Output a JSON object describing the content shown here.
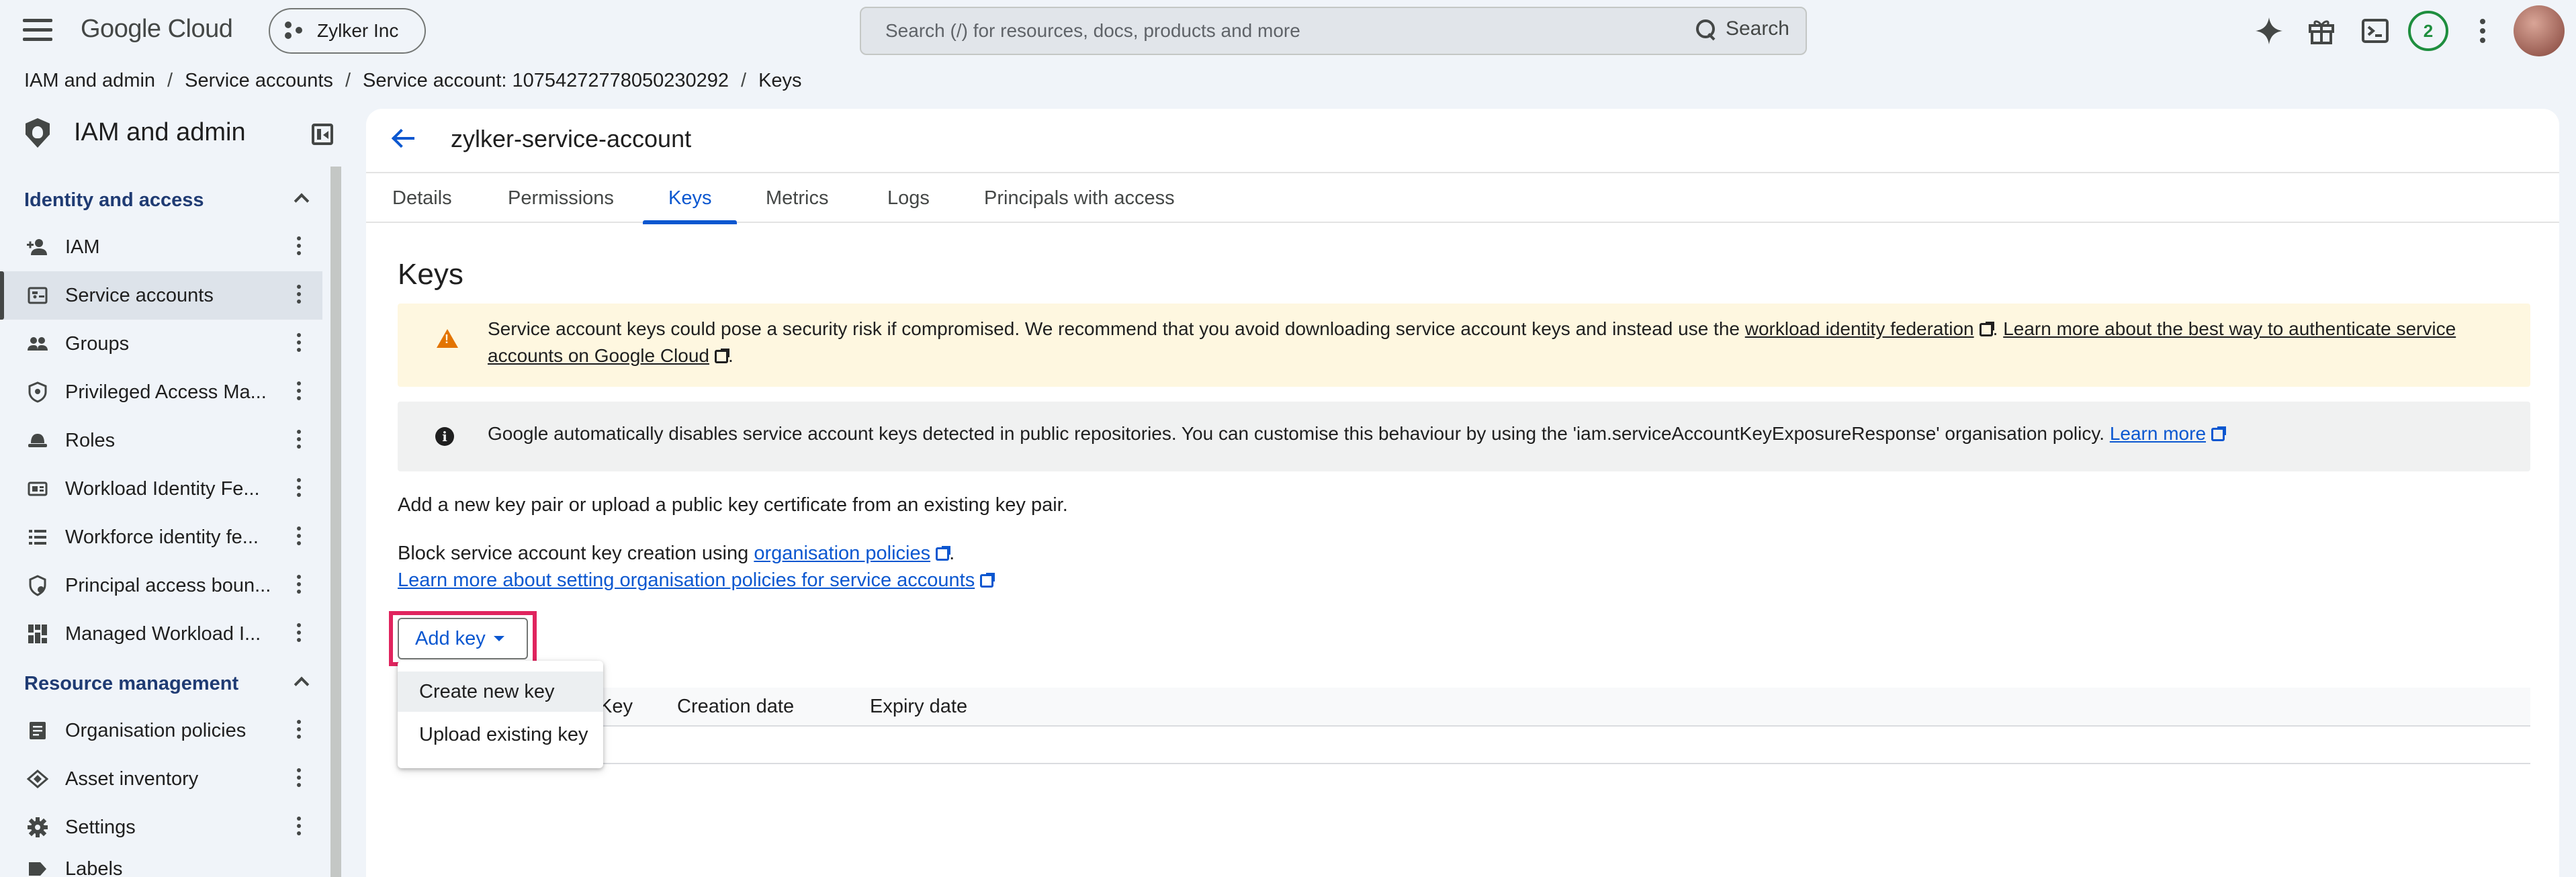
{
  "header": {
    "logo": "Google Cloud",
    "org": "Zylker Inc",
    "search_placeholder": "Search (/) for resources, docs, products and more",
    "search_button": "Search",
    "notification_count": "2"
  },
  "breadcrumb": [
    "IAM and admin",
    "Service accounts",
    "Service account: 107542727780502302​92",
    "Keys"
  ],
  "sidebar": {
    "title": "IAM and admin",
    "section1": "Identity and access",
    "section2": "Resource management",
    "items": [
      {
        "label": "IAM",
        "icon": "person-add-icon"
      },
      {
        "label": "Service accounts",
        "icon": "service-account-icon"
      },
      {
        "label": "Groups",
        "icon": "groups-icon"
      },
      {
        "label": "Privileged Access Ma...",
        "icon": "privileged-access-icon"
      },
      {
        "label": "Roles",
        "icon": "roles-icon"
      },
      {
        "label": "Workload Identity Fe...",
        "icon": "workload-identity-icon"
      },
      {
        "label": "Workforce identity fe...",
        "icon": "workforce-identity-icon"
      },
      {
        "label": "Principal access boun...",
        "icon": "principal-access-icon"
      },
      {
        "label": "Managed Workload I...",
        "icon": "managed-workload-icon"
      }
    ],
    "items2": [
      {
        "label": "Organisation policies",
        "icon": "org-policies-icon"
      },
      {
        "label": "Asset inventory",
        "icon": "asset-inventory-icon"
      },
      {
        "label": "Settings",
        "icon": "settings-icon"
      },
      {
        "label": "Labels",
        "icon": "labels-icon"
      }
    ]
  },
  "main": {
    "account_title": "zylker-service-account",
    "tabs": [
      "Details",
      "Permissions",
      "Keys",
      "Metrics",
      "Logs",
      "Principals with access"
    ],
    "active_tab": "Keys",
    "heading": "Keys",
    "warning": {
      "text1": "Service account keys could pose a security risk if compromised. We recommend that you avoid downloading service account keys and instead use the ",
      "link1": "workload identity federation",
      "text2": ". ",
      "link2a": "Learn more about the best way to authenticate service",
      "link2b": "accounts on Google Cloud",
      "text3": "."
    },
    "info": {
      "text": "Google automatically disables service account keys detected in public repositories. You can customise this behaviour by using the 'iam.serviceAccountKeyExposureResponse' organisation policy. ",
      "link": "Learn more"
    },
    "para1": "Add a new key pair or upload a public key certificate from an existing key pair.",
    "para2_text": "Block service account key creation using ",
    "para2_link": "organisation policies",
    "para2_end": ".",
    "para3_link": "Learn more about setting organisation policies for service accounts",
    "add_key": "Add key",
    "table_headers": [
      "Key",
      "Creation date",
      "Expiry date"
    ],
    "menu": [
      "Create new key",
      "Upload existing key"
    ]
  },
  "colors": {
    "accent": "#0b57d0",
    "highlight": "#e0245e",
    "warning_bg": "#fef7e0",
    "warning_icon": "#e37400"
  }
}
